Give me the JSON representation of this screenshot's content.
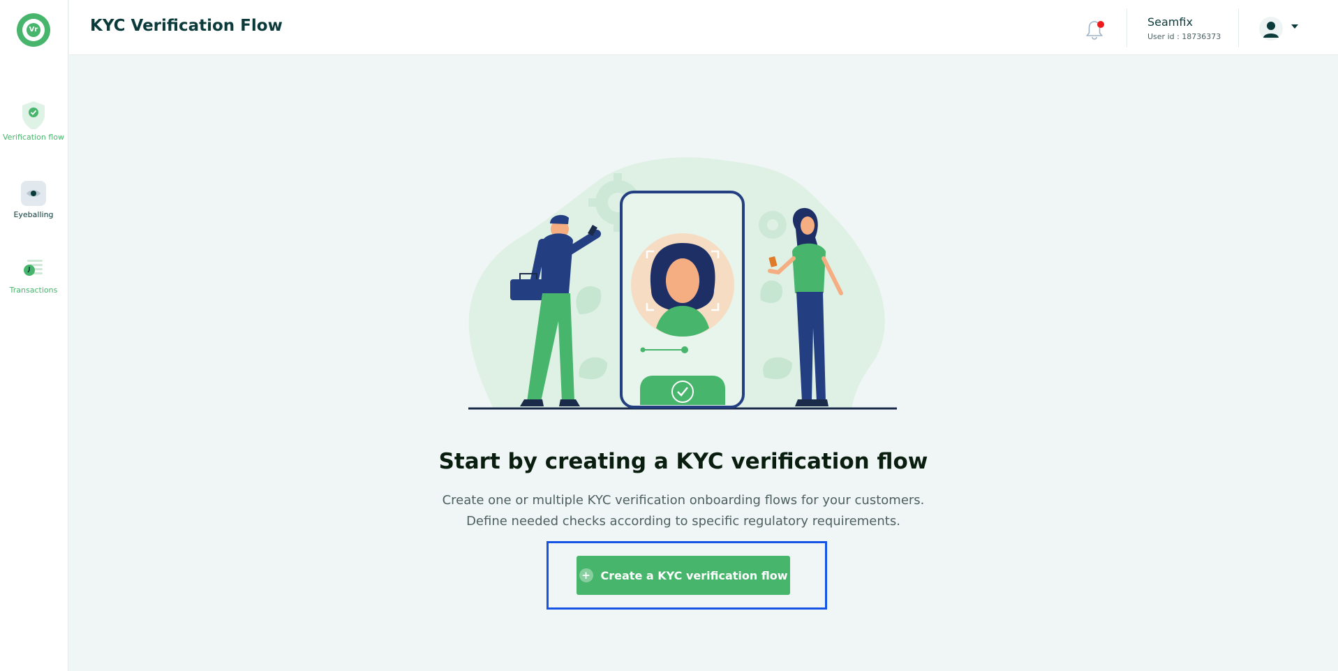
{
  "app": {
    "logo_text": "Vr"
  },
  "sidebar": {
    "items": [
      {
        "label": "Verification flow",
        "icon": "shield-check-icon",
        "active": true
      },
      {
        "label": "Eyeballing",
        "icon": "eye-icon",
        "active": false
      },
      {
        "label": "Transactions",
        "icon": "transactions-icon",
        "active": false
      }
    ]
  },
  "header": {
    "title": "KYC Verification Flow",
    "notification_icon": "bell-icon",
    "has_unread_notification": true,
    "user": {
      "name": "Seamfix",
      "id_text": "User id : 18736373"
    }
  },
  "main": {
    "headline": "Start by creating a KYC verification flow",
    "subtext_line1": "Create one or multiple KYC verification onboarding flows for your customers.",
    "subtext_line2": "Define needed checks according to specific regulatory requirements.",
    "cta_label": "Create a KYC verification flow",
    "cta_icon": "plus-circle-icon"
  },
  "colors": {
    "brand_green": "#47b56b",
    "dark_teal": "#0b3a3a",
    "highlight_blue": "#1552e6",
    "notification_red": "#ee1b1b",
    "background": "#f0f5f6"
  }
}
